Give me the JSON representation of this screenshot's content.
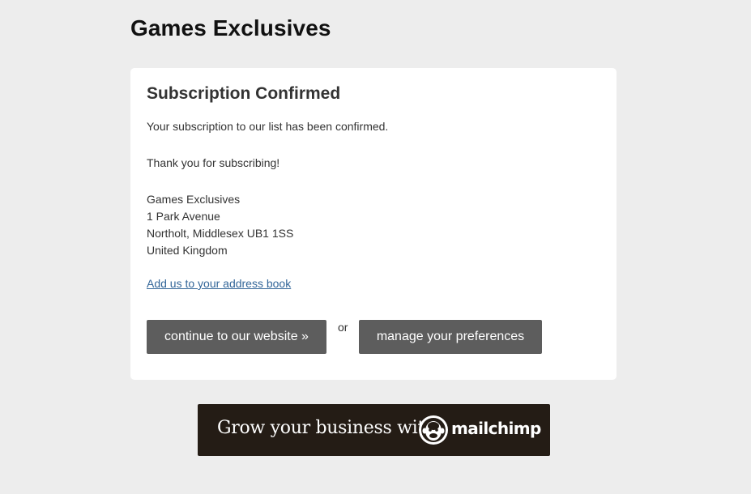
{
  "header": {
    "brand": "Games Exclusives"
  },
  "card": {
    "title": "Subscription Confirmed",
    "message": "Your subscription to our list has been confirmed.",
    "thanks": "Thank you for subscribing!",
    "address": {
      "name": "Games Exclusives",
      "line1": "1 Park Avenue",
      "line2": "Northolt, Middlesex UB1 1SS",
      "country": "United Kingdom"
    },
    "address_book_link": "Add us to your address book",
    "continue_button": "continue to our website »",
    "or_text": "or",
    "manage_button": "manage your preferences"
  },
  "banner": {
    "tagline": "Grow your business with",
    "brand_word": "mailchimp",
    "icon": "mailchimp-freddie-icon"
  },
  "colors": {
    "page_bg": "#ededed",
    "card_bg": "#ffffff",
    "button_bg": "#5d5d5d",
    "link": "#336699",
    "banner_bg": "#241c15"
  }
}
